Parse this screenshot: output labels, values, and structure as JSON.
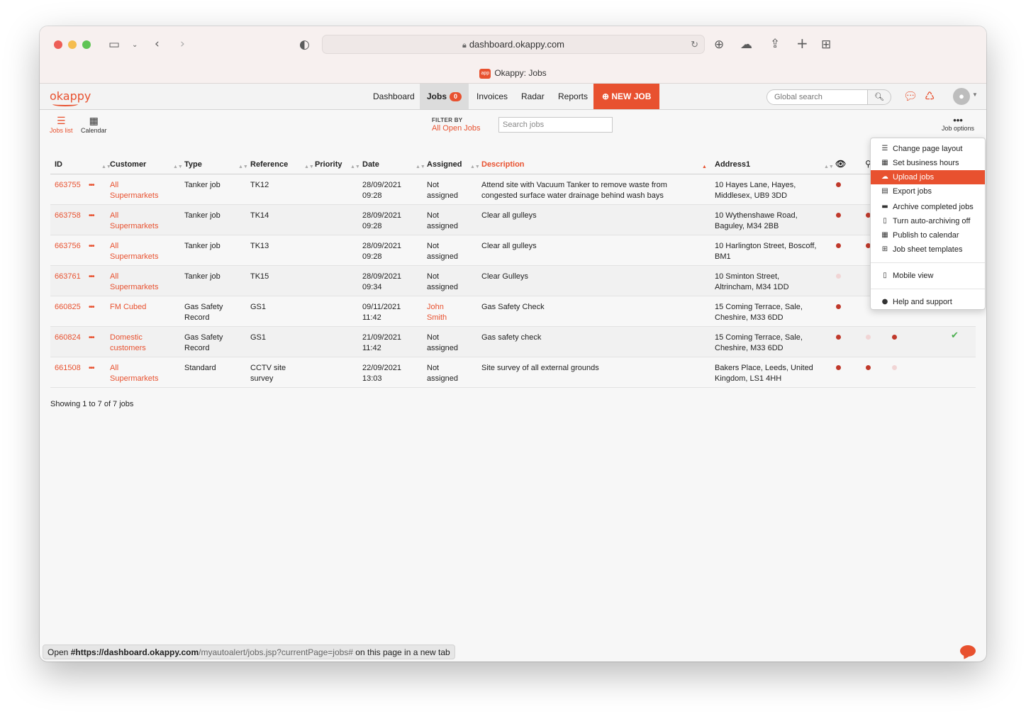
{
  "browser": {
    "url": "dashboard.okappy.com",
    "tab_title": "Okappy: Jobs",
    "favicon_text": "app"
  },
  "app": {
    "logo": "okappy",
    "nav": {
      "dashboard": "Dashboard",
      "jobs": "Jobs",
      "jobs_count": "0",
      "invoices": "Invoices",
      "radar": "Radar",
      "reports": "Reports",
      "new_job": "NEW JOB"
    },
    "global_search_placeholder": "Global search"
  },
  "toolbar": {
    "jobs_list": "Jobs list",
    "calendar": "Calendar",
    "filter_caption": "FILTER BY",
    "filter_value": "All Open Jobs",
    "search_placeholder": "Search jobs",
    "job_options": "Job options"
  },
  "table": {
    "headers": [
      "ID",
      "Customer",
      "Type",
      "Reference",
      "Priority",
      "Date",
      "Assigned",
      "Description",
      "Address1"
    ],
    "rows": [
      {
        "id": "663755",
        "customer": [
          "All",
          "Supermarkets"
        ],
        "type": [
          "Tanker job"
        ],
        "ref": [
          "TK12"
        ],
        "date": [
          "28/09/2021",
          "09:28"
        ],
        "assigned": [
          "Not",
          "assigned"
        ],
        "desc": [
          "Attend site with Vacuum Tanker to remove waste from",
          "congested surface water drainage behind wash bays"
        ],
        "addr": [
          "10 Hayes Lane, Hayes,",
          "Middlesex, UB9 3DD"
        ]
      },
      {
        "id": "663758",
        "customer": [
          "All",
          "Supermarkets"
        ],
        "type": [
          "Tanker job"
        ],
        "ref": [
          "TK14"
        ],
        "date": [
          "28/09/2021",
          "09:28"
        ],
        "assigned": [
          "Not",
          "assigned"
        ],
        "desc": [
          "Clear all gulleys"
        ],
        "addr": [
          "10 Wythenshawe Road,",
          "Baguley, M34 2BB"
        ]
      },
      {
        "id": "663756",
        "customer": [
          "All",
          "Supermarkets"
        ],
        "type": [
          "Tanker job"
        ],
        "ref": [
          "TK13"
        ],
        "date": [
          "28/09/2021",
          "09:28"
        ],
        "assigned": [
          "Not",
          "assigned"
        ],
        "desc": [
          "Clear all gulleys"
        ],
        "addr": [
          "10 Harlington Street, Boscoff,",
          "BM1"
        ]
      },
      {
        "id": "663761",
        "customer": [
          "All",
          "Supermarkets"
        ],
        "type": [
          "Tanker job"
        ],
        "ref": [
          "TK15"
        ],
        "date": [
          "28/09/2021",
          "09:34"
        ],
        "assigned": [
          "Not",
          "assigned"
        ],
        "desc": [
          "Clear Gulleys"
        ],
        "addr": [
          "10 Sminton Street,",
          "Altrincham, M34 1DD"
        ]
      },
      {
        "id": "660825",
        "customer": [
          "FM Cubed"
        ],
        "type": [
          "Gas Safety",
          "Record"
        ],
        "ref": [
          "GS1"
        ],
        "date": [
          "09/11/2021",
          "11:42"
        ],
        "assigned": [
          "John",
          "Smith"
        ],
        "desc": [
          "Gas Safety Check"
        ],
        "addr": [
          "15 Coming Terrace, Sale,",
          "Cheshire, M33 6DD"
        ]
      },
      {
        "id": "660824",
        "customer": [
          "Domestic",
          "customers"
        ],
        "type": [
          "Gas Safety",
          "Record"
        ],
        "ref": [
          "GS1"
        ],
        "date": [
          "21/09/2021",
          "11:42"
        ],
        "assigned": [
          "Not",
          "assigned"
        ],
        "desc": [
          "Gas safety check"
        ],
        "addr": [
          "15 Coming Terrace, Sale,",
          "Cheshire, M33 6DD"
        ]
      },
      {
        "id": "661508",
        "customer": [
          "All",
          "Supermarkets"
        ],
        "type": [
          "Standard"
        ],
        "ref": [
          "CCTV site",
          "survey"
        ],
        "date": [
          "22/09/2021",
          "13:03"
        ],
        "assigned": [
          "Not",
          "assigned"
        ],
        "desc": [
          "Site survey of all external grounds"
        ],
        "addr": [
          "Bakers Place, Leeds, United",
          "Kingdom, LS1 4HH"
        ]
      }
    ],
    "footer": "Showing 1 to 7 of 7 jobs"
  },
  "menu": {
    "items": [
      "Change page layout",
      "Set business hours",
      "Upload jobs",
      "Export jobs",
      "Archive completed jobs",
      "Turn auto-archiving off",
      "Publish to calendar",
      "Job sheet templates",
      "Mobile view",
      "Help and support"
    ],
    "active": "Upload jobs"
  },
  "status": {
    "prefix": "Open ",
    "link_bold": "#https://dashboard.okappy.com",
    "link_rest": "/myautoalert/jobs.jsp?currentPage=jobs#",
    "suffix": " on this page in a new tab"
  },
  "colors": {
    "accent": "#e8512f",
    "dot": "#c0392b",
    "check": "#4caf50"
  }
}
